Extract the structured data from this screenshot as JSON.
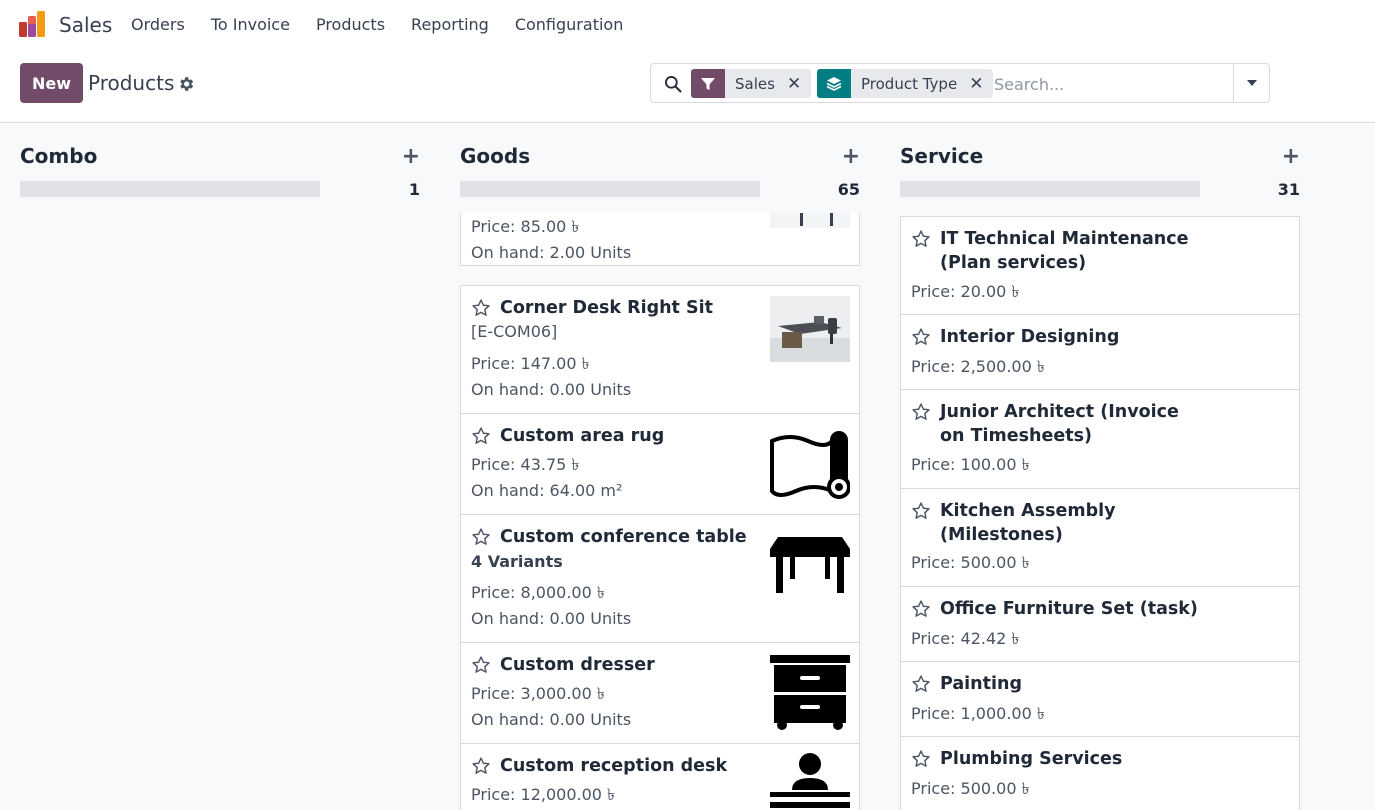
{
  "navbar": {
    "app_name": "Sales",
    "menu": [
      "Orders",
      "To Invoice",
      "Products",
      "Reporting",
      "Configuration"
    ]
  },
  "control": {
    "new_label": "New",
    "title": "Products",
    "facets": [
      {
        "label": "Sales",
        "icon": "filter-icon",
        "color": "#714B67"
      },
      {
        "label": "Product Type",
        "icon": "layers-icon",
        "color": "#017E84"
      }
    ],
    "search_placeholder": "Search..."
  },
  "columns": [
    {
      "title": "Combo",
      "count": "1"
    },
    {
      "title": "Goods",
      "count": "65"
    },
    {
      "title": "Service",
      "count": "31"
    }
  ],
  "goods_cards": [
    {
      "price": "Price: 85.00 ৳",
      "onhand": "On hand: 2.00 Units",
      "image": "office-desk-photo"
    },
    {
      "name": "Corner Desk Right Sit",
      "ref": "[E-COM06]",
      "price": "Price: 147.00 ৳",
      "onhand": "On hand: 0.00 Units",
      "image": "corner-desk-photo"
    },
    {
      "name": "Custom area rug",
      "price": "Price: 43.75 ৳",
      "onhand": "On hand: 64.00 m²",
      "image": "rug-icon"
    },
    {
      "name": "Custom conference table",
      "variants": "4 Variants",
      "price": "Price: 8,000.00 ৳",
      "onhand": "On hand: 0.00 Units",
      "image": "table-icon"
    },
    {
      "name": "Custom dresser",
      "price": "Price: 3,000.00 ৳",
      "onhand": "On hand: 0.00 Units",
      "image": "dresser-icon"
    },
    {
      "name": "Custom reception desk",
      "price": "Price: 12,000.00 ৳",
      "image": "reception-desk-icon"
    }
  ],
  "service_cards": [
    {
      "name": "IT Technical Maintenance (Plan services)",
      "price": "Price: 20.00 ৳"
    },
    {
      "name": "Interior Designing",
      "price": "Price: 2,500.00 ৳"
    },
    {
      "name": "Junior Architect (Invoice on Timesheets)",
      "price": "Price: 100.00 ৳"
    },
    {
      "name": "Kitchen Assembly (Milestones)",
      "price": "Price: 500.00 ৳"
    },
    {
      "name": "Office Furniture Set (task)",
      "price": "Price: 42.42 ৳"
    },
    {
      "name": "Painting",
      "price": "Price: 1,000.00 ৳"
    },
    {
      "name": "Plumbing Services",
      "price": "Price: 500.00 ৳"
    }
  ]
}
